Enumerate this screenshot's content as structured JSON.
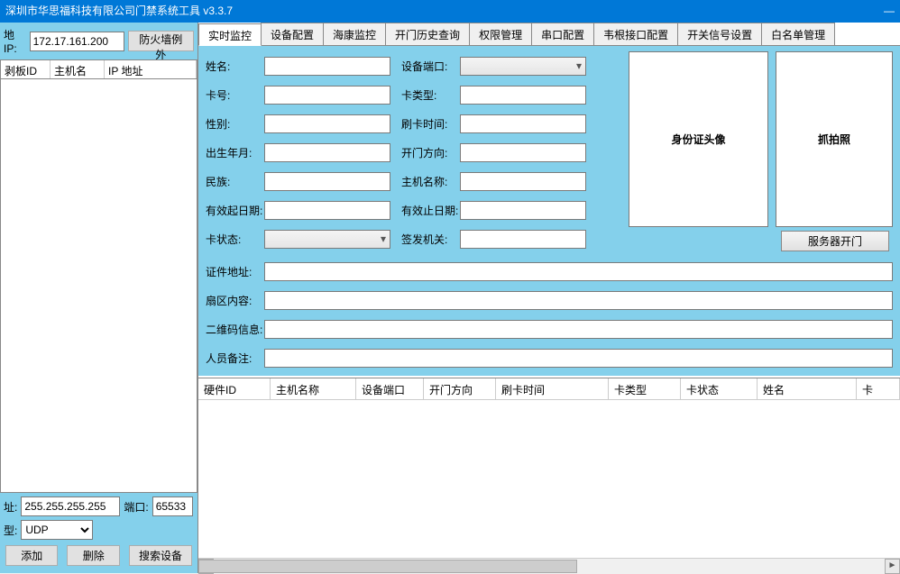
{
  "window": {
    "title": "深圳市华思福科技有限公司门禁系统工具 v3.3.7"
  },
  "left": {
    "ip_label": "地IP:",
    "ip_value": "172.17.161.200",
    "firewall_btn": "防火墙例外",
    "grid_cols": {
      "id": "剥板ID",
      "host": "主机名",
      "ip": "IP 地址"
    },
    "addr_label": "址:",
    "addr_value": "255.255.255.255",
    "port_label": "端口:",
    "port_value": "65533",
    "type_label": "型:",
    "type_value": "UDP",
    "btn_add": "添加",
    "btn_del": "删除",
    "btn_search": "搜索设备"
  },
  "tabs": [
    "实时监控",
    "设备配置",
    "海康监控",
    "开门历史查询",
    "权限管理",
    "串口配置",
    "韦根接口配置",
    "开关信号设置",
    "白名单管理"
  ],
  "active_tab": 0,
  "form": {
    "name": "姓名:",
    "card_no": "卡号:",
    "gender": "性别:",
    "birth": "出生年月:",
    "nation": "民族:",
    "valid_from": "有效起日期:",
    "card_state": "卡状态:",
    "device_port": "设备端口:",
    "card_type": "卡类型:",
    "swipe_time": "刷卡时间:",
    "open_dir": "开门方向:",
    "host_name": "主机名称:",
    "valid_to": "有效止日期:",
    "issuer": "签发机关:",
    "cert_addr": "证件地址:",
    "area_content": "扇区内容:",
    "qr_info": "二维码信息:",
    "person_remark": "人员备注:",
    "photo1": "身份证头像",
    "photo2": "抓拍照",
    "server_open": "服务器开门"
  },
  "table_cols": [
    "硬件ID",
    "主机名称",
    "设备端口",
    "开门方向",
    "刷卡时间",
    "卡类型",
    "卡状态",
    "姓名",
    "卡"
  ]
}
